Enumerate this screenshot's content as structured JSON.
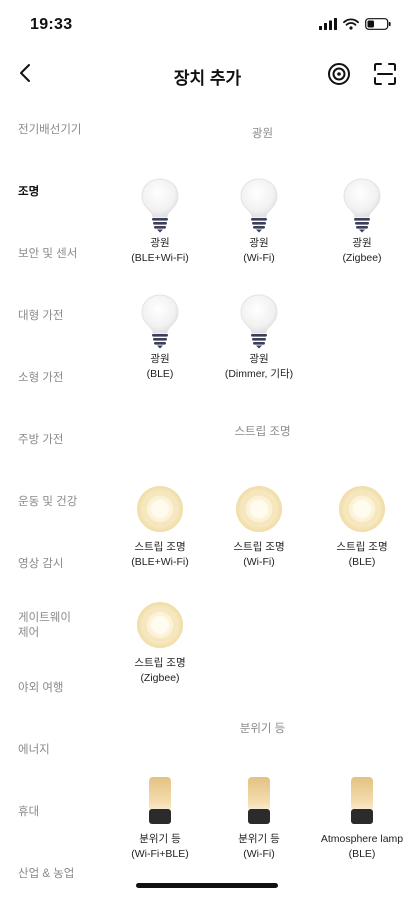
{
  "status_bar": {
    "time": "19:33"
  },
  "header": {
    "title": "장치 추가"
  },
  "sidebar": {
    "categories": [
      {
        "label": "전기배선기기",
        "active": false
      },
      {
        "label": "조명",
        "active": true
      },
      {
        "label": "보안 및 센서",
        "active": false
      },
      {
        "label": "대형 가전",
        "active": false
      },
      {
        "label": "소형 가전",
        "active": false
      },
      {
        "label": "주방 가전",
        "active": false
      },
      {
        "label": "운동 및 건강",
        "active": false
      },
      {
        "label": "영상 감시",
        "active": false
      },
      {
        "label": "게이트웨이 제어",
        "active": false
      },
      {
        "label": "야외 여행",
        "active": false
      },
      {
        "label": "에너지",
        "active": false
      },
      {
        "label": "휴대",
        "active": false
      },
      {
        "label": "산업 & 농업",
        "active": false
      }
    ]
  },
  "sections": [
    {
      "title": "광원",
      "devices": [
        {
          "name": "광원",
          "sub": "(BLE+Wi-Fi)",
          "icon": "bulb-icon"
        },
        {
          "name": "광원",
          "sub": "(Wi-Fi)",
          "icon": "bulb-icon"
        },
        {
          "name": "광원",
          "sub": "(Zigbee)",
          "icon": "bulb-icon"
        },
        {
          "name": "광원",
          "sub": "(BLE)",
          "icon": "bulb-icon"
        },
        {
          "name": "광원",
          "sub": "(Dimmer, 기타)",
          "icon": "bulb-icon"
        }
      ]
    },
    {
      "title": "스트립 조명",
      "devices": [
        {
          "name": "스트립 조명",
          "sub": "(BLE+Wi-Fi)",
          "icon": "light-strip-icon"
        },
        {
          "name": "스트립 조명",
          "sub": "(Wi-Fi)",
          "icon": "light-strip-icon"
        },
        {
          "name": "스트립 조명",
          "sub": "(BLE)",
          "icon": "light-strip-icon"
        },
        {
          "name": "스트립 조명",
          "sub": "(Zigbee)",
          "icon": "light-strip-icon"
        }
      ]
    },
    {
      "title": "분위기 등",
      "devices": [
        {
          "name": "분위기 등",
          "sub": "(Wi-Fi+BLE)",
          "icon": "ambient-lamp-icon"
        },
        {
          "name": "분위기 등",
          "sub": "(Wi-Fi)",
          "icon": "ambient-lamp-icon"
        },
        {
          "name": "Atmosphere lamp",
          "sub": "(BLE)",
          "icon": "ambient-lamp-icon"
        }
      ]
    }
  ],
  "colors": {
    "text_primary": "#111111",
    "text_secondary": "#8a8a8a",
    "lamp_amber": "#e8c27a",
    "lamp_base": "#2b2b2b"
  }
}
